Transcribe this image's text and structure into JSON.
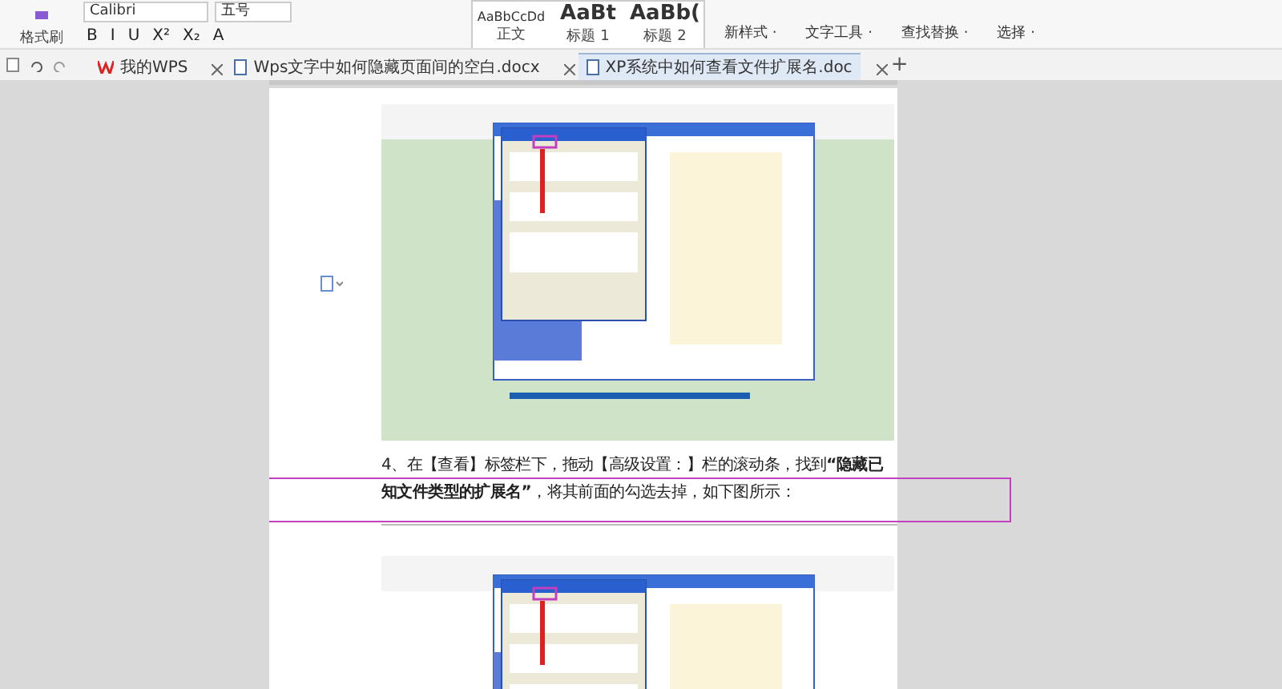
{
  "ribbon": {
    "format_painter": "格式刷",
    "font_name": "Calibri",
    "font_size": "五号",
    "format_buttons": [
      "B",
      "I",
      "U",
      "X²",
      "X₂",
      "A"
    ],
    "styles": [
      {
        "preview": "AaBbCcDd",
        "label": "正文",
        "kind": "small"
      },
      {
        "preview": "AaBt",
        "label": "标题 1",
        "kind": "large"
      },
      {
        "preview": "AaBb(",
        "label": "标题 2",
        "kind": "large"
      }
    ],
    "tools": [
      "新样式 ·",
      "文字工具 ·",
      "查找替换 ·",
      "选择 ·"
    ]
  },
  "tabs": [
    {
      "label": "我的WPS",
      "kind": "home",
      "selected": false
    },
    {
      "label": "Wps文字中如何隐藏页面间的空白.docx",
      "kind": "document",
      "selected": false
    },
    {
      "label": "XP系统中如何查看文件扩展名.doc",
      "kind": "document",
      "selected": true
    }
  ],
  "new_tab": "+",
  "document": {
    "paragraph": "4、在【查看】标签栏下，拖动【高级设置：】栏的滚动条，找到**“隐藏已知文件类型的扩展名”**，将其前面的勾选去掉，如下图所示："
  }
}
